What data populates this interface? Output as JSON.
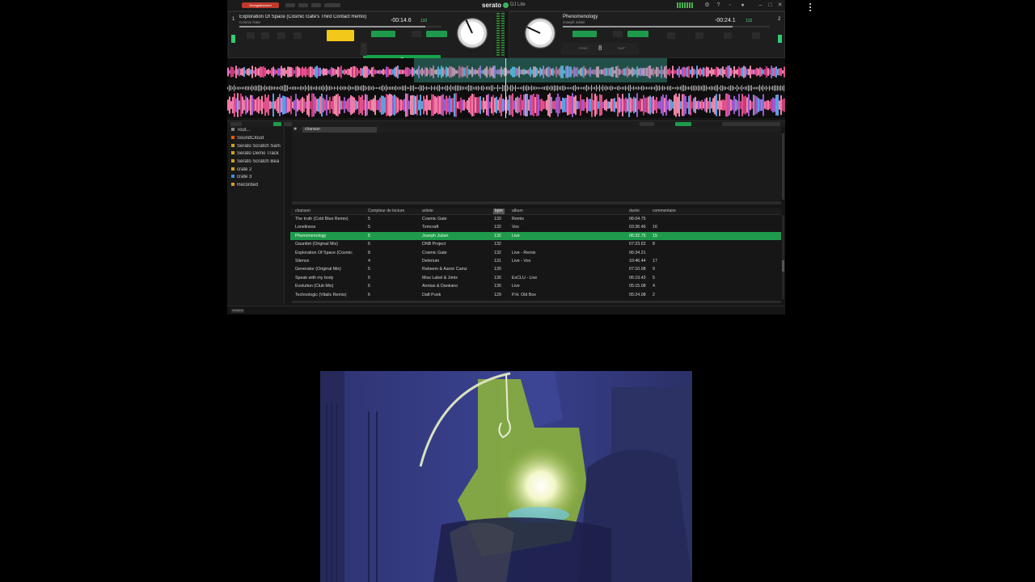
{
  "titlebar": {
    "record_label": "Enregistrement",
    "brand": "serato",
    "product": "DJ Lite"
  },
  "deck_left": {
    "number": "1",
    "track_title": "Exploration Of Space (Cosmic Gate's Third Contact Remix)",
    "artist": "Cosmic Gate",
    "time_remaining": "-00:14.6",
    "bpm": "132",
    "progress": 0.92,
    "platter_angle": -25,
    "mid_left": "SYNC",
    "mid_center": "8",
    "mid_right": "SLIP",
    "accent": "#f2c81a"
  },
  "deck_right": {
    "number": "2",
    "track_title": "Phenomenology",
    "artist": "Joseph Julian",
    "time_remaining": "-00:24.1",
    "bpm": "132",
    "progress": 0.82,
    "platter_angle": -65,
    "mid_left": "SYNC",
    "mid_center": "8",
    "mid_right": "SLIP"
  },
  "library": {
    "sidebar_items": [
      {
        "label": "Tout...",
        "color": "#888888"
      },
      {
        "label": "SoundCloud",
        "color": "#ff5500"
      },
      {
        "label": "Serato Scratch Sam",
        "color": "#d4a017"
      },
      {
        "label": "Serato Demo Track",
        "color": "#d4a017"
      },
      {
        "label": "Serato Scratch Bea",
        "color": "#d4a017"
      },
      {
        "label": "crate 2",
        "color": "#d4a017"
      },
      {
        "label": "crate 3",
        "color": "#3a8fd6"
      },
      {
        "label": "Recorded",
        "color": "#d4a017"
      }
    ],
    "upper_tab": "chanson",
    "columns": [
      "chanson",
      "Compteur de lecture",
      "artiste",
      "bpm",
      "album",
      "durée",
      "commentaire"
    ],
    "rows": [
      {
        "song": "The truth (Cold Blue Remix)",
        "count": "5",
        "artist": "Cosmic Gate",
        "bpm": "133",
        "album": "Remix",
        "duration": "06:04.75",
        "comment": ""
      },
      {
        "song": "Loneliness",
        "count": "5",
        "artist": "Tomcraft",
        "bpm": "132",
        "album": "Vox",
        "duration": "03:36.46",
        "comment": "16"
      },
      {
        "song": "Phenomenology",
        "count": "5",
        "artist": "Joseph Julian",
        "bpm": "132",
        "album": "Live",
        "duration": "06:32.75",
        "comment": "15"
      },
      {
        "song": "Gauntlet (Original Mix)",
        "count": "6",
        "artist": "DNB Project",
        "bpm": "132",
        "album": "",
        "duration": "07:23.62",
        "comment": "8"
      },
      {
        "song": "Exploration Of Space (Cosmic",
        "count": "8",
        "artist": "Cosmic Gate",
        "bpm": "132",
        "album": "Live - Remix",
        "duration": "06:34.21",
        "comment": ""
      },
      {
        "song": "Silence",
        "count": "4",
        "artist": "Delerium",
        "bpm": "131",
        "album": "Live - Vox",
        "duration": "10:46.44",
        "comment": "17"
      },
      {
        "song": "Generator (Original Mix)",
        "count": "5",
        "artist": "Raheem & Aaron Camz",
        "bpm": "130",
        "album": "",
        "duration": "07:10.08",
        "comment": "9"
      },
      {
        "song": "Speak with my body",
        "count": "6",
        "artist": "Miss Label & Jimix",
        "bpm": "130",
        "album": "ExCLU - Live",
        "duration": "06:19.43",
        "comment": "5"
      },
      {
        "song": "Evolution (Club Mix)",
        "count": "6",
        "artist": "Anntas & Dankano",
        "bpm": "130",
        "album": "Live",
        "duration": "05:15.08",
        "comment": "4"
      },
      {
        "song": "Technologic (Vitalic Remix)",
        "count": "6",
        "artist": "Daft Punk",
        "bpm": "129",
        "album": "P.H. Old Box",
        "duration": "05:24.08",
        "comment": "2"
      }
    ],
    "selected_index": 2,
    "footer_button": "Autoplay"
  }
}
